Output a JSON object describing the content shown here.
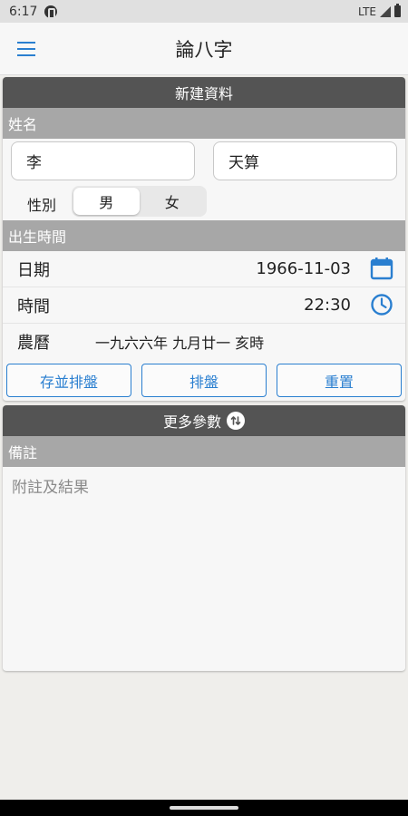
{
  "status": {
    "time": "6:17",
    "network": "LTE"
  },
  "appbar": {
    "title": "論八字"
  },
  "form": {
    "header": "新建資料",
    "name_section": "姓名",
    "surname": "李",
    "given_name": "天算",
    "gender_label": "性別",
    "gender_options": [
      "男",
      "女"
    ],
    "gender_selected": "男",
    "birth_section": "出生時間",
    "date_label": "日期",
    "date_value": "1966-11-03",
    "time_label": "時間",
    "time_value": "22:30",
    "lunar_label": "農曆",
    "lunar_value": "一九六六年 九月廿一 亥時",
    "buttons": {
      "save_chart": "存並排盤",
      "chart": "排盤",
      "reset": "重置"
    },
    "accent_color": "#2a7fd0"
  },
  "more": {
    "header": "更多參數",
    "notes_section": "備註",
    "notes_placeholder": "附註及結果"
  }
}
